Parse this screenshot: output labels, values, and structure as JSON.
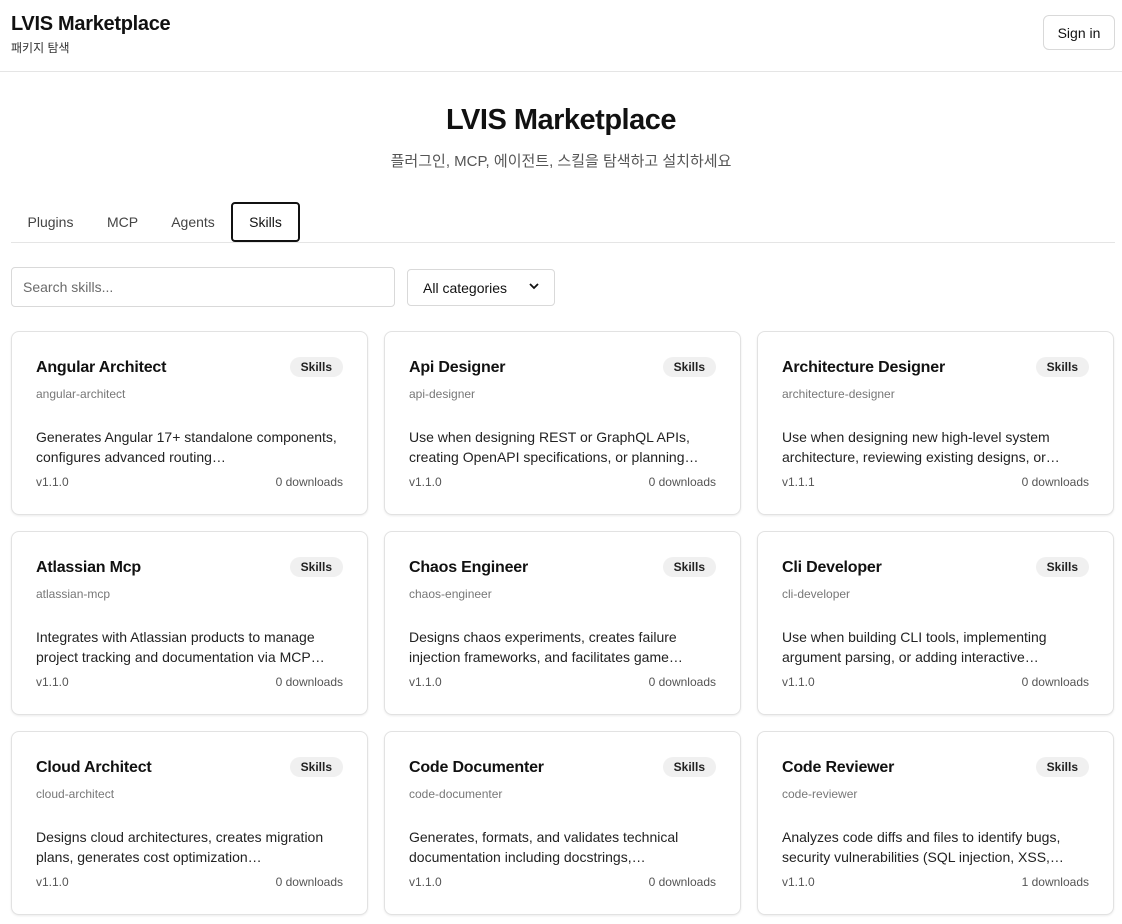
{
  "header": {
    "title": "LVIS Marketplace",
    "subtitle": "패키지 탐색",
    "sign_in_label": "Sign in"
  },
  "hero": {
    "title": "LVIS Marketplace",
    "subtitle": "플러그인, MCP, 에이전트, 스킬을 탐색하고 설치하세요"
  },
  "tabs": [
    {
      "label": "Plugins",
      "active": false
    },
    {
      "label": "MCP",
      "active": false
    },
    {
      "label": "Agents",
      "active": false
    },
    {
      "label": "Skills",
      "active": true
    }
  ],
  "filters": {
    "search_placeholder": "Search skills...",
    "search_value": "",
    "category_selected": "All categories",
    "chevron_icon": "chevron-down-icon"
  },
  "cards": [
    {
      "title": "Angular Architect",
      "badge": "Skills",
      "slug": "angular-architect",
      "description": "Generates Angular 17+ standalone components, configures advanced routing…",
      "version": "v1.1.0",
      "downloads": "0 downloads"
    },
    {
      "title": "Api Designer",
      "badge": "Skills",
      "slug": "api-designer",
      "description": "Use when designing REST or GraphQL APIs, creating OpenAPI specifications, or planning…",
      "version": "v1.1.0",
      "downloads": "0 downloads"
    },
    {
      "title": "Architecture Designer",
      "badge": "Skills",
      "slug": "architecture-designer",
      "description": "Use when designing new high-level system architecture, reviewing existing designs, or…",
      "version": "v1.1.1",
      "downloads": "0 downloads"
    },
    {
      "title": "Atlassian Mcp",
      "badge": "Skills",
      "slug": "atlassian-mcp",
      "description": "Integrates with Atlassian products to manage project tracking and documentation via MCP…",
      "version": "v1.1.0",
      "downloads": "0 downloads"
    },
    {
      "title": "Chaos Engineer",
      "badge": "Skills",
      "slug": "chaos-engineer",
      "description": "Designs chaos experiments, creates failure injection frameworks, and facilitates game…",
      "version": "v1.1.0",
      "downloads": "0 downloads"
    },
    {
      "title": "Cli Developer",
      "badge": "Skills",
      "slug": "cli-developer",
      "description": "Use when building CLI tools, implementing argument parsing, or adding interactive…",
      "version": "v1.1.0",
      "downloads": "0 downloads"
    },
    {
      "title": "Cloud Architect",
      "badge": "Skills",
      "slug": "cloud-architect",
      "description": "Designs cloud architectures, creates migration plans, generates cost optimization…",
      "version": "v1.1.0",
      "downloads": "0 downloads"
    },
    {
      "title": "Code Documenter",
      "badge": "Skills",
      "slug": "code-documenter",
      "description": "Generates, formats, and validates technical documentation including docstrings,…",
      "version": "v1.1.0",
      "downloads": "0 downloads"
    },
    {
      "title": "Code Reviewer",
      "badge": "Skills",
      "slug": "code-reviewer",
      "description": "Analyzes code diffs and files to identify bugs, security vulnerabilities (SQL injection, XSS,…",
      "version": "v1.1.0",
      "downloads": "1 downloads"
    }
  ]
}
